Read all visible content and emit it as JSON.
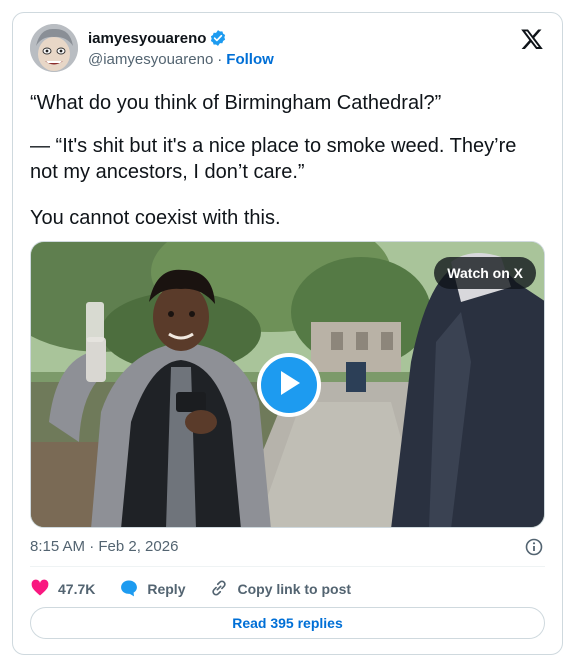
{
  "author": {
    "display_name": "iamyesyouareno",
    "handle": "@iamyesyouareno",
    "separator": "·",
    "follow_label": "Follow",
    "verified_color": "#1d9bf0"
  },
  "tweet": {
    "line1": "“What do you think of Birmingham Cathedral?”",
    "line2": "— “It's shit but it's a nice place to smoke weed. They’re not my ancestors, I don’t care.”",
    "line3": "You cannot coexist with this."
  },
  "media": {
    "watch_label": "Watch on X",
    "play_icon": "play-icon"
  },
  "meta": {
    "timestamp": "8:15 AM · Feb 2, 2026"
  },
  "actions": {
    "likes": "47.7K",
    "reply_label": "Reply",
    "copy_label": "Copy link to post",
    "like_color": "#f91880",
    "reply_color": "#1d9bf0"
  },
  "read_replies_label": "Read 395 replies",
  "colors": {
    "link": "#006fd6",
    "muted": "#536471",
    "accent": "#1d9bf0"
  }
}
